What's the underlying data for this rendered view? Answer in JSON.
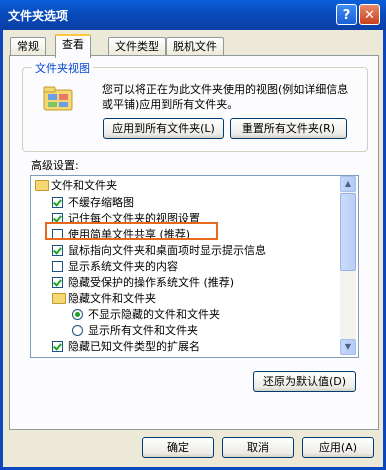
{
  "window": {
    "title": "文件夹选项",
    "help_glyph": "?",
    "close_glyph": "✕"
  },
  "tabs": [
    {
      "label": "常规",
      "active": false
    },
    {
      "label": "查看",
      "active": true
    },
    {
      "label": "文件类型",
      "active": false
    },
    {
      "label": "脱机文件",
      "active": false
    }
  ],
  "folder_view": {
    "group_title": "文件夹视图",
    "description": "您可以将正在为此文件夹使用的视图(例如详细信息或平铺)应用到所有文件夹。",
    "apply_all_label": "应用到所有文件夹(L)",
    "reset_all_label": "重置所有文件夹(R)"
  },
  "advanced": {
    "label": "高级设置:",
    "items": [
      {
        "type": "folder",
        "text": "文件和文件夹",
        "indent": 0
      },
      {
        "type": "checkbox",
        "text": "不缓存缩略图",
        "checked": true,
        "indent": 1
      },
      {
        "type": "checkbox",
        "text": "记住每个文件夹的视图设置",
        "checked": true,
        "indent": 1
      },
      {
        "type": "checkbox",
        "text": "使用简单文件共享 (推荐)",
        "checked": false,
        "indent": 1
      },
      {
        "type": "checkbox",
        "text": "鼠标指向文件夹和桌面项时显示提示信息",
        "checked": true,
        "indent": 1
      },
      {
        "type": "checkbox",
        "text": "显示系统文件夹的内容",
        "checked": false,
        "indent": 1
      },
      {
        "type": "checkbox",
        "text": "隐藏受保护的操作系统文件 (推荐)",
        "checked": true,
        "indent": 1
      },
      {
        "type": "folder",
        "text": "隐藏文件和文件夹",
        "indent": 1
      },
      {
        "type": "radio",
        "text": "不显示隐藏的文件和文件夹",
        "checked": true,
        "indent": 2
      },
      {
        "type": "radio",
        "text": "显示所有文件和文件夹",
        "checked": false,
        "indent": 2
      },
      {
        "type": "checkbox",
        "text": "隐藏已知文件类型的扩展名",
        "checked": true,
        "indent": 1
      }
    ],
    "restore_defaults_label": "还原为默认值(D)"
  },
  "footer": {
    "ok_label": "确定",
    "cancel_label": "取消",
    "apply_label": "应用(A)"
  },
  "colors": {
    "highlight_border": "#e8681c",
    "titlebar": "#0a5fd8"
  }
}
